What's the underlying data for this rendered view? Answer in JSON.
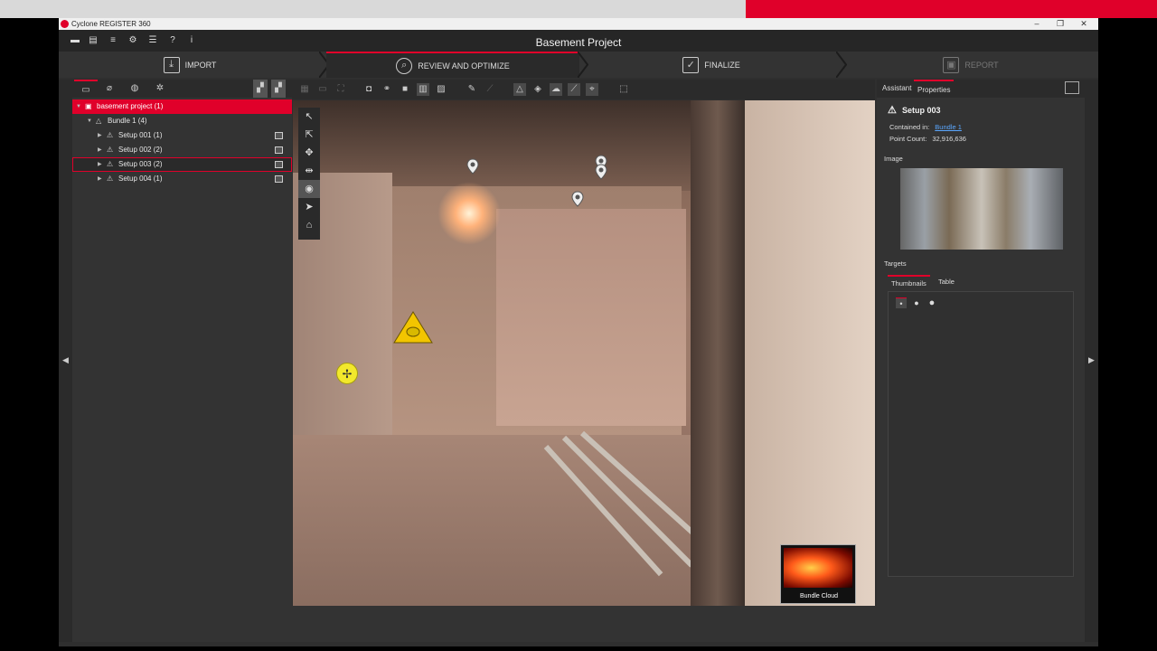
{
  "app": {
    "title": "Cyclone REGISTER 360",
    "project_title": "Basement Project"
  },
  "window_controls": {
    "minimize": "–",
    "restore": "❐",
    "close": "✕"
  },
  "workflow": {
    "steps": [
      {
        "label": "IMPORT",
        "icon": "import-icon",
        "state": "normal"
      },
      {
        "label": "REVIEW AND OPTIMIZE",
        "icon": "review-icon",
        "state": "active"
      },
      {
        "label": "FINALIZE",
        "icon": "finalize-check-icon",
        "state": "normal"
      },
      {
        "label": "REPORT",
        "icon": "report-icon",
        "state": "disabled"
      }
    ]
  },
  "tree": {
    "root": {
      "label": "basement project (1)"
    },
    "bundle": {
      "label": "Bundle 1 (4)"
    },
    "setups": [
      {
        "label": "Setup 001 (1)"
      },
      {
        "label": "Setup 002 (2)"
      },
      {
        "label": "Setup 003 (2)"
      },
      {
        "label": "Setup 004 (1)"
      }
    ]
  },
  "viewer": {
    "bundle_thumb_label": "Bundle Cloud"
  },
  "right_panel": {
    "tabs": [
      "Assistant",
      "Properties"
    ],
    "selected_title": "Setup 003",
    "contained_in_label": "Contained in:",
    "contained_in_value": "Bundle 1",
    "point_count_label": "Point Count:",
    "point_count_value": "32,916,636",
    "image_section": "Image",
    "targets_section": "Targets",
    "targets_tabs": [
      "Thumbnails",
      "Table"
    ]
  },
  "colors": {
    "accent": "#e0002a",
    "link": "#5aa7ff",
    "background": "#2f2f2f"
  }
}
